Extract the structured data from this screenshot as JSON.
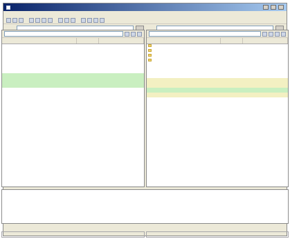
{
  "window": {
    "title": ""
  },
  "menu": [
    "",
    "",
    "",
    "",
    "",
    "",
    ""
  ],
  "address": {
    "left_label": "",
    "left_value": "",
    "right_label": "",
    "right_value": ""
  },
  "left_pane": {
    "path": "",
    "columns": [
      "",
      "",
      ""
    ],
    "rows": [
      {
        "highlight": "",
        "cells": [
          "",
          "",
          ""
        ]
      },
      {
        "highlight": "",
        "cells": [
          "",
          "",
          ""
        ]
      },
      {
        "highlight": "",
        "cells": [
          "",
          "",
          ""
        ]
      },
      {
        "highlight": "",
        "cells": [
          "",
          "",
          ""
        ]
      },
      {
        "highlight": "",
        "cells": [
          "",
          "",
          ""
        ]
      },
      {
        "highlight": "",
        "cells": [
          "",
          "",
          ""
        ]
      },
      {
        "highlight": "green",
        "cells": [
          "",
          "",
          ""
        ]
      },
      {
        "highlight": "green",
        "cells": [
          "",
          "",
          ""
        ]
      },
      {
        "highlight": "green",
        "cells": [
          "",
          "",
          ""
        ]
      },
      {
        "highlight": "",
        "cells": [
          "",
          "",
          ""
        ]
      },
      {
        "highlight": "",
        "cells": [
          "",
          "",
          ""
        ]
      },
      {
        "highlight": "",
        "cells": [
          "",
          "",
          ""
        ]
      }
    ]
  },
  "right_pane": {
    "path": "",
    "columns": [
      "",
      "",
      ""
    ],
    "rows": [
      {
        "folder": true,
        "highlight": "",
        "cells": [
          "",
          "",
          ""
        ]
      },
      {
        "folder": true,
        "highlight": "",
        "cells": [
          "",
          "",
          ""
        ]
      },
      {
        "folder": true,
        "highlight": "",
        "cells": [
          "",
          "",
          ""
        ]
      },
      {
        "folder": true,
        "highlight": "",
        "cells": [
          "",
          "",
          ""
        ]
      },
      {
        "highlight": "",
        "cells": [
          "",
          "",
          ""
        ]
      },
      {
        "highlight": "",
        "cells": [
          "",
          "",
          ""
        ]
      },
      {
        "highlight": "",
        "cells": [
          "",
          "",
          ""
        ]
      },
      {
        "highlight": "yellow",
        "cells": [
          "",
          "",
          ""
        ]
      },
      {
        "highlight": "yellow",
        "cells": [
          "",
          "",
          ""
        ]
      },
      {
        "highlight": "green",
        "cells": [
          "",
          "",
          ""
        ]
      },
      {
        "highlight": "yellow",
        "cells": [
          "",
          "",
          ""
        ]
      },
      {
        "highlight": "",
        "cells": [
          "",
          "",
          ""
        ]
      }
    ]
  },
  "log": {
    "text": ""
  },
  "status": {
    "left": "",
    "right": ""
  },
  "colors": {
    "title_start": "#0a246a",
    "title_end": "#a6caf0",
    "highlight_green": "#c9efc0",
    "highlight_yellow": "#f3f0c2",
    "folder": "#f0d36b"
  },
  "icons": {
    "toolbar": "toolbar-button-icon",
    "folder": "folder-icon"
  }
}
